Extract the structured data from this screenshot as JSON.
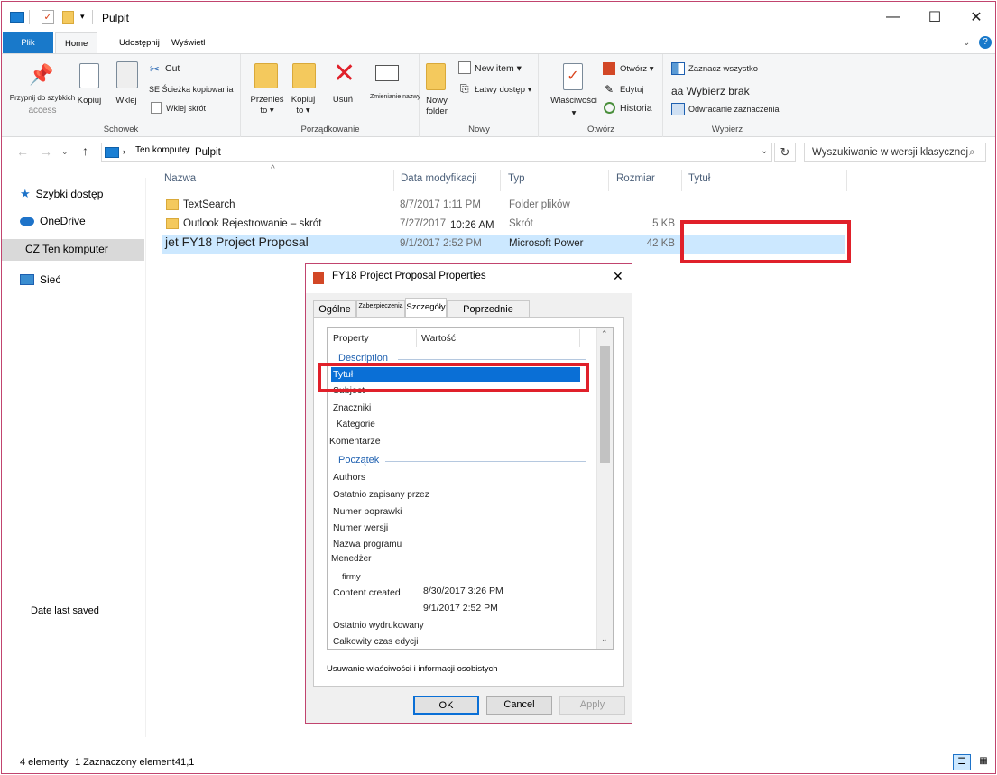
{
  "window": {
    "title": "Pulpit",
    "minimize_glyph": "—",
    "maximize_glyph": "☐",
    "close_glyph": "✕"
  },
  "ribbon_tabs": [
    "Plik",
    "Home",
    "Udostępnij",
    "Wyświetl"
  ],
  "ribbon": {
    "schowek": {
      "label": "Schowek",
      "pin_line1": "Przypnij do szybkich",
      "pin_line2": "access",
      "copy": "Kopiuj",
      "paste": "Wklej",
      "cut": "Cut",
      "copy_path": "SE Ścieżka kopiowania",
      "paste_shortcut": "Wklej skrót"
    },
    "porzadkowanie": {
      "label": "Porządkowanie",
      "move_to_1": "Przenieś",
      "move_to_2": "to ▾",
      "copy_to_1": "Kopiuj",
      "copy_to_2": "to ▾",
      "delete": "Usuń",
      "rename": "Zmienianie nazwy"
    },
    "nowy": {
      "label": "Nowy",
      "new_folder_1": "Nowy",
      "new_folder_2": "folder",
      "new_item": "New item ▾",
      "easy_access": "Łatwy dostęp ▾"
    },
    "otworz": {
      "label": "Otwórz",
      "properties": "Właściwości",
      "open": "Otwórz ▾",
      "edit": "Edytuj",
      "history": "Historia"
    },
    "wybierz": {
      "label": "Wybierz",
      "select_all": "Zaznacz wszystko",
      "select_none": "aa Wybierz brak",
      "invert": "Odwracanie zaznaczenia"
    }
  },
  "address": {
    "crumb1": "Ten komputer",
    "crumb2": "Pulpit",
    "search_placeholder": "Wyszukiwanie w wersji klasycznej"
  },
  "nav": {
    "quick": "Szybki dostęp",
    "onedrive": "OneDrive",
    "thispc": "CZ Ten komputer",
    "network": "Sieć",
    "date_last_saved": "Date last saved"
  },
  "columns": [
    "Nazwa",
    "Data modyfikacji",
    "Typ",
    "Rozmiar",
    "Tytuł"
  ],
  "files": [
    {
      "name": "TextSearch",
      "date": "8/7/2017 1:11 PM",
      "type": "Folder plików",
      "size": ""
    },
    {
      "name": "Outlook Rejestrowanie – skrót",
      "date": "7/27/2017",
      "time": "10:26 AM",
      "type": "Skrót",
      "size": "5 KB"
    },
    {
      "name": "jet FY18 Project Proposal",
      "date": "9/1/2017 2:52 PM",
      "type": "Microsoft Power",
      "size": "42 KB"
    }
  ],
  "dialog": {
    "title": "FY18 Project Proposal Properties",
    "tabs": [
      "Ogólne",
      "Zabezpieczenia",
      "Szczegóły",
      "Poprzednie wersje"
    ],
    "col_property": "Property",
    "col_value": "Wartość",
    "section_description": "Description",
    "rows_description": [
      "Tytuł",
      "Subject",
      "Znaczniki",
      "Kategorie",
      "Komentarze"
    ],
    "section_origin": "Początek",
    "rows_origin": [
      "Authors",
      "Ostatnio zapisany przez",
      "Numer poprawki",
      "Numer wersji",
      "Nazwa programu",
      "Menedżer",
      "firmy",
      "Content created",
      "",
      "Ostatnio wydrukowany",
      "Całkowity czas edycji"
    ],
    "content_created": "8/30/2017 3:26 PM",
    "date_saved_value": "9/1/2017 2:52 PM",
    "remove_link": "Usuwanie właściwości i informacji osobistych",
    "ok": "OK",
    "cancel": "Cancel",
    "apply": "Apply"
  },
  "status": {
    "items": "4 elementy",
    "selected": "1 Zaznaczony element",
    "size": "41,1"
  }
}
